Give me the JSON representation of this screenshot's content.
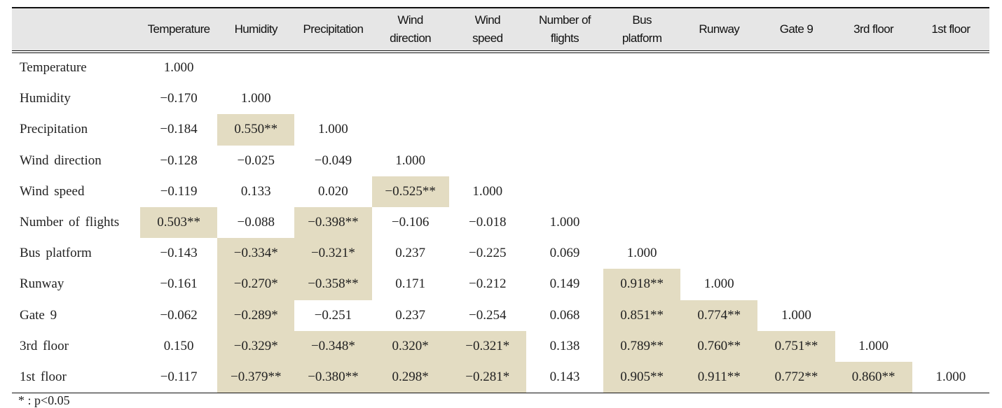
{
  "table": {
    "columns": [
      "Temperature",
      "Humidity",
      "Precipitation",
      "Wind\ndirection",
      "Wind\nspeed",
      "Number of\nflights",
      "Bus\nplatform",
      "Runway",
      "Gate 9",
      "3rd floor",
      "1st floor"
    ],
    "rows": [
      {
        "label": "Temperature",
        "cells": [
          "1.000"
        ]
      },
      {
        "label": "Humidity",
        "cells": [
          "−0.170",
          "1.000"
        ]
      },
      {
        "label": "Precipitation",
        "cells": [
          "−0.184",
          "0.550**",
          "1.000"
        ]
      },
      {
        "label": "Wind direction",
        "cells": [
          "−0.128",
          "−0.025",
          "−0.049",
          "1.000"
        ]
      },
      {
        "label": "Wind speed",
        "cells": [
          "−0.119",
          "0.133",
          "0.020",
          "−0.525**",
          "1.000"
        ]
      },
      {
        "label": "Number of flights",
        "cells": [
          "0.503**",
          "−0.088",
          "−0.398**",
          "−0.106",
          "−0.018",
          "1.000"
        ]
      },
      {
        "label": "Bus platform",
        "cells": [
          "−0.143",
          "−0.334*",
          "−0.321*",
          "0.237",
          "−0.225",
          "0.069",
          "1.000"
        ]
      },
      {
        "label": "Runway",
        "cells": [
          "−0.161",
          "−0.270*",
          "−0.358**",
          "0.171",
          "−0.212",
          "0.149",
          "0.918**",
          "1.000"
        ]
      },
      {
        "label": "Gate 9",
        "cells": [
          "−0.062",
          "−0.289*",
          "−0.251",
          "0.237",
          "−0.254",
          "0.068",
          "0.851**",
          "0.774**",
          "1.000"
        ]
      },
      {
        "label": "3rd floor",
        "cells": [
          "0.150",
          "−0.329*",
          "−0.348*",
          "0.320*",
          "−0.321*",
          "0.138",
          "0.789**",
          "0.760**",
          "0.751**",
          "1.000"
        ]
      },
      {
        "label": "1st floor",
        "cells": [
          "−0.117",
          "−0.379**",
          "−0.380**",
          "0.298*",
          "−0.281*",
          "0.143",
          "0.905**",
          "0.911**",
          "0.772**",
          "0.860**",
          "1.000"
        ]
      }
    ],
    "highlight_color": "#e3dcc2",
    "header_bg": "#e6e6e6"
  },
  "footnote": "* : p<0.05"
}
